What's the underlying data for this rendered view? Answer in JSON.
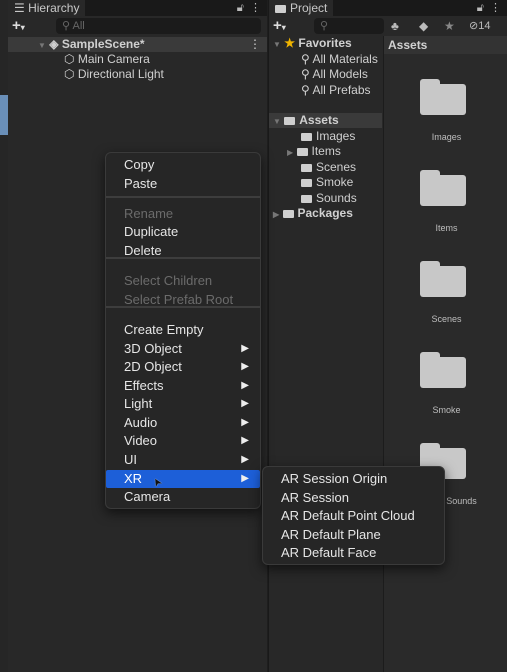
{
  "hierarchy": {
    "tab": "Hierarchy",
    "search_placeholder": "All",
    "scene": "SampleScene*",
    "items": [
      "Main Camera",
      "Directional Light"
    ]
  },
  "project": {
    "tab": "Project",
    "hidden_count": "14",
    "favorites": {
      "label": "Favorites",
      "items": [
        "All Materials",
        "All Models",
        "All Prefabs"
      ]
    },
    "assets": {
      "label": "Assets",
      "children": [
        "Images",
        "Items",
        "Scenes",
        "Smoke",
        "Sounds"
      ]
    },
    "packages": "Packages",
    "grid": {
      "header": "Assets",
      "folders": [
        "Images",
        "Items",
        "Scenes",
        "Smoke",
        "Sounds"
      ]
    }
  },
  "context_menu": {
    "items": [
      {
        "label": "Copy"
      },
      {
        "label": "Paste"
      },
      {
        "label": "Rename",
        "disabled": true
      },
      {
        "label": "Duplicate"
      },
      {
        "label": "Delete"
      },
      {
        "label": "Select Children",
        "disabled": true
      },
      {
        "label": "Select Prefab Root",
        "disabled": true
      },
      {
        "label": "Create Empty"
      },
      {
        "label": "3D Object",
        "submenu": true
      },
      {
        "label": "2D Object",
        "submenu": true
      },
      {
        "label": "Effects",
        "submenu": true
      },
      {
        "label": "Light",
        "submenu": true
      },
      {
        "label": "Audio",
        "submenu": true
      },
      {
        "label": "Video",
        "submenu": true
      },
      {
        "label": "UI",
        "submenu": true
      },
      {
        "label": "XR",
        "submenu": true,
        "selected": true
      },
      {
        "label": "Camera"
      }
    ]
  },
  "xr_submenu": {
    "items": [
      "AR Session Origin",
      "AR Session",
      "AR Default Point Cloud",
      "AR Default Plane",
      "AR Default Face"
    ]
  },
  "colors": {
    "highlight": "#1d5fd8",
    "panel": "#282828",
    "star": "#f0b400"
  }
}
